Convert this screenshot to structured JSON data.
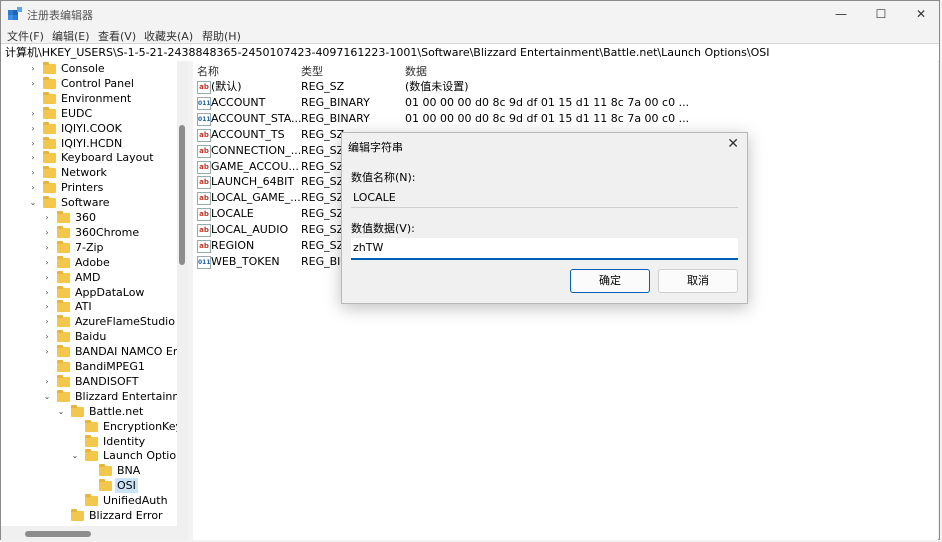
{
  "window": {
    "title": "注册表编辑器",
    "minimize": "—",
    "maximize": "☐",
    "close": "✕"
  },
  "menu": [
    "文件(F)",
    "编辑(E)",
    "查看(V)",
    "收藏夹(A)",
    "帮助(H)"
  ],
  "address": "计算机\\HKEY_USERS\\S-1-5-21-2438848365-2450107423-4097161223-1001\\Software\\Blizzard Entertainment\\Battle.net\\Launch Options\\OSI",
  "tree": [
    {
      "label": "Console",
      "level": 1,
      "chevron": "›"
    },
    {
      "label": "Control Panel",
      "level": 1,
      "chevron": "›"
    },
    {
      "label": "Environment",
      "level": 1,
      "chevron": ""
    },
    {
      "label": "EUDC",
      "level": 1,
      "chevron": "›"
    },
    {
      "label": "IQIYI.COOK",
      "level": 1,
      "chevron": "›"
    },
    {
      "label": "IQIYI.HCDN",
      "level": 1,
      "chevron": "›"
    },
    {
      "label": "Keyboard Layout",
      "level": 1,
      "chevron": "›"
    },
    {
      "label": "Network",
      "level": 1,
      "chevron": "›"
    },
    {
      "label": "Printers",
      "level": 1,
      "chevron": "›"
    },
    {
      "label": "Software",
      "level": 1,
      "chevron": "⌄"
    },
    {
      "label": "360",
      "level": 2,
      "chevron": "›"
    },
    {
      "label": "360Chrome",
      "level": 2,
      "chevron": "›"
    },
    {
      "label": "7-Zip",
      "level": 2,
      "chevron": "›"
    },
    {
      "label": "Adobe",
      "level": 2,
      "chevron": "›"
    },
    {
      "label": "AMD",
      "level": 2,
      "chevron": "›"
    },
    {
      "label": "AppDataLow",
      "level": 2,
      "chevron": "›"
    },
    {
      "label": "ATI",
      "level": 2,
      "chevron": "›"
    },
    {
      "label": "AzureFlameStudio",
      "level": 2,
      "chevron": "›"
    },
    {
      "label": "Baidu",
      "level": 2,
      "chevron": "›"
    },
    {
      "label": "BANDAI NAMCO En",
      "level": 2,
      "chevron": "›"
    },
    {
      "label": "BandiMPEG1",
      "level": 2,
      "chevron": ""
    },
    {
      "label": "BANDISOFT",
      "level": 2,
      "chevron": "›"
    },
    {
      "label": "Blizzard Entertainme",
      "level": 2,
      "chevron": "⌄"
    },
    {
      "label": "Battle.net",
      "level": 3,
      "chevron": "⌄"
    },
    {
      "label": "EncryptionKey",
      "level": 4,
      "chevron": ""
    },
    {
      "label": "Identity",
      "level": 4,
      "chevron": ""
    },
    {
      "label": "Launch Option",
      "level": 4,
      "chevron": "⌄"
    },
    {
      "label": "BNA",
      "level": 5,
      "chevron": ""
    },
    {
      "label": "OSI",
      "level": 5,
      "chevron": "",
      "selected": true
    },
    {
      "label": "UnifiedAuth",
      "level": 4,
      "chevron": ""
    },
    {
      "label": "Blizzard Error",
      "level": 3,
      "chevron": ""
    }
  ],
  "columns": {
    "name": "名称",
    "type": "类型",
    "data": "数据"
  },
  "values": [
    {
      "name": "(默认)",
      "type": "REG_SZ",
      "data": "(数值未设置)",
      "icon": "ab"
    },
    {
      "name": "ACCOUNT",
      "type": "REG_BINARY",
      "data": "01 00 00 00 d0 8c 9d df 01 15 d1 11 8c 7a 00 c0 ...",
      "icon": "bin"
    },
    {
      "name": "ACCOUNT_STA...",
      "type": "REG_BINARY",
      "data": "01 00 00 00 d0 8c 9d df 01 15 d1 11 8c 7a 00 c0 ...",
      "icon": "bin"
    },
    {
      "name": "ACCOUNT_TS",
      "type": "REG_SZ",
      "data": "",
      "icon": "ab"
    },
    {
      "name": "CONNECTION_...",
      "type": "REG_SZ",
      "data": "",
      "icon": "ab"
    },
    {
      "name": "GAME_ACCOU...",
      "type": "REG_SZ",
      "data": "",
      "icon": "ab"
    },
    {
      "name": "LAUNCH_64BIT",
      "type": "REG_SZ",
      "data": "",
      "icon": "ab"
    },
    {
      "name": "LOCAL_GAME_...",
      "type": "REG_SZ",
      "data": "",
      "icon": "ab"
    },
    {
      "name": "LOCALE",
      "type": "REG_SZ",
      "data": "",
      "icon": "ab"
    },
    {
      "name": "LOCAL_AUDIO",
      "type": "REG_SZ",
      "data": "",
      "icon": "ab"
    },
    {
      "name": "REGION",
      "type": "REG_SZ",
      "data": "",
      "icon": "ab"
    },
    {
      "name": "WEB_TOKEN",
      "type": "REG_BIN",
      "data": "",
      "icon": "bin"
    }
  ],
  "dialog": {
    "title": "编辑字符串",
    "close": "✕",
    "name_label": "数值名称(N):",
    "name_value": "LOCALE",
    "data_label": "数值数据(V):",
    "data_value": "zhTW",
    "ok": "确定",
    "cancel": "取消"
  }
}
